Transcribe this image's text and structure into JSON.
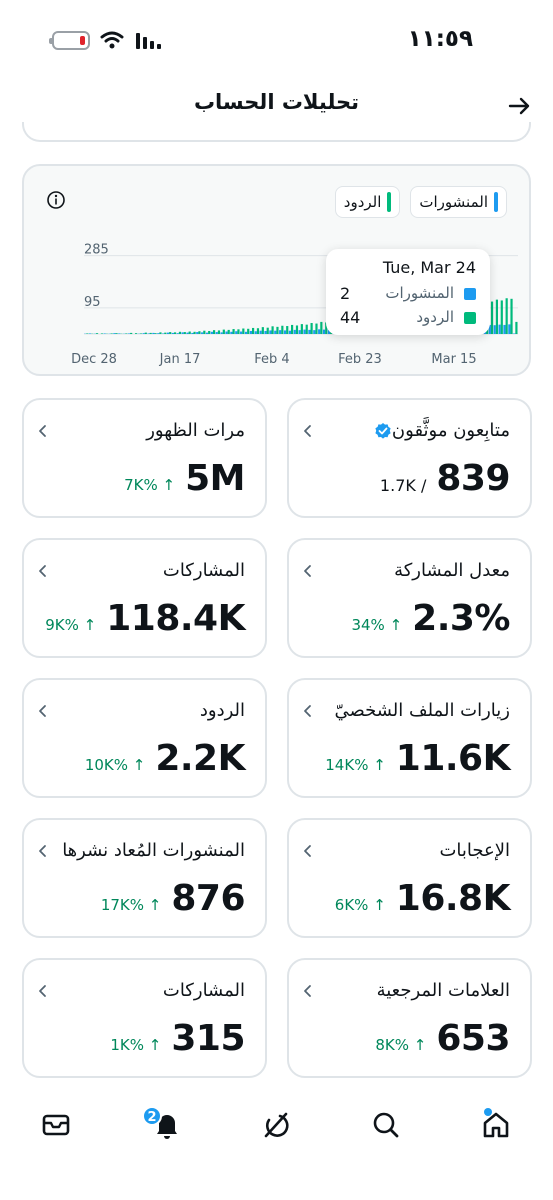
{
  "status_bar": {
    "time": "١١:٥٩"
  },
  "header": {
    "title": "تحليلات الحساب"
  },
  "chart": {
    "legend": [
      {
        "label": "المنشورات",
        "color": "#1d9bf0"
      },
      {
        "label": "الردود",
        "color": "#00ba7c"
      }
    ],
    "tooltip": {
      "date": "Tue, Mar 24",
      "rows": [
        {
          "label": "المنشورات",
          "value": "2",
          "color": "#1d9bf0"
        },
        {
          "label": "الردود",
          "value": "44",
          "color": "#00ba7c"
        }
      ]
    }
  },
  "chart_data": {
    "type": "bar",
    "x_tick_labels": [
      "Dec 28",
      "Jan 17",
      "Feb 4",
      "Feb 23",
      "Mar 15"
    ],
    "y_tick_labels": [
      "285",
      "95"
    ],
    "ylim": [
      0,
      320
    ],
    "grid": true,
    "legend_position": "top-right",
    "series": [
      {
        "name": "المنشورات",
        "color": "#1d9bf0",
        "values": [
          1,
          2,
          1,
          0,
          2,
          1,
          3,
          2,
          1,
          2,
          0,
          1,
          3,
          2,
          4,
          3,
          2,
          5,
          4,
          3,
          6,
          5,
          4,
          7,
          6,
          5,
          8,
          7,
          6,
          9,
          8,
          10,
          9,
          8,
          11,
          10,
          12,
          11,
          13,
          12,
          14,
          13,
          12,
          15,
          14,
          16,
          15,
          14,
          17,
          16,
          18,
          17,
          16,
          19,
          18,
          20,
          19,
          18,
          21,
          20,
          22,
          21,
          23,
          22,
          24,
          23,
          25,
          24,
          26,
          25,
          27,
          26,
          28,
          27,
          29,
          28,
          30,
          29,
          31,
          30,
          32,
          31,
          30,
          33,
          32,
          34,
          33,
          35,
          2
        ]
      },
      {
        "name": "الردود",
        "color": "#00ba7c",
        "values": [
          2,
          1,
          3,
          2,
          1,
          2,
          3,
          1,
          2,
          4,
          3,
          2,
          5,
          4,
          3,
          6,
          5,
          7,
          6,
          8,
          7,
          9,
          8,
          10,
          12,
          11,
          14,
          13,
          16,
          15,
          18,
          17,
          20,
          19,
          22,
          21,
          25,
          23,
          28,
          26,
          30,
          29,
          33,
          31,
          36,
          34,
          40,
          38,
          44,
          42,
          48,
          46,
          52,
          50,
          56,
          54,
          60,
          58,
          64,
          62,
          68,
          66,
          72,
          70,
          76,
          74,
          80,
          78,
          85,
          83,
          90,
          88,
          95,
          93,
          100,
          98,
          105,
          102,
          110,
          108,
          115,
          112,
          120,
          118,
          125,
          122,
          130,
          128,
          44
        ]
      }
    ]
  },
  "cards": [
    {
      "label": "متابِعون موثَّقون",
      "value": "839",
      "sub": "1.7K /",
      "verified": true
    },
    {
      "label": "مرات الظهور",
      "value": "5M",
      "change": "7K% ↑"
    },
    {
      "label": "معدل المشاركة",
      "value": "2.3%",
      "change": "34% ↑"
    },
    {
      "label": "المشاركات",
      "value": "118.4K",
      "change": "9K% ↑"
    },
    {
      "label": "زيارات الملف الشخصيّ",
      "value": "11.6K",
      "change": "14K% ↑"
    },
    {
      "label": "الردود",
      "value": "2.2K",
      "change": "10K% ↑"
    },
    {
      "label": "الإعجابات",
      "value": "16.8K",
      "change": "6K% ↑"
    },
    {
      "label": "المنشورات المُعاد نشرها",
      "value": "876",
      "change": "17K% ↑"
    },
    {
      "label": "العلامات المرجعية",
      "value": "653",
      "change": "8K% ↑"
    },
    {
      "label": "المشاركات",
      "value": "315",
      "change": "1K% ↑"
    }
  ],
  "bottom_nav": {
    "notifications_badge": "2",
    "items": [
      "messages-icon",
      "notifications-icon",
      "grok-icon",
      "search-icon",
      "home-icon"
    ]
  }
}
